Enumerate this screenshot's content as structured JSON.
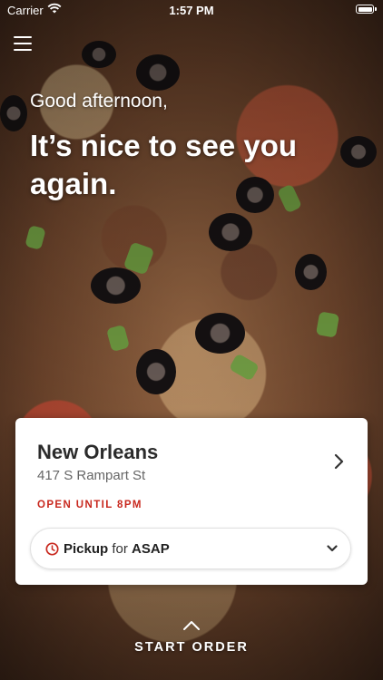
{
  "status_bar": {
    "carrier": "Carrier",
    "time": "1:57 PM",
    "wifi_icon": "wifi-icon",
    "battery_icon": "battery-icon"
  },
  "menu": {
    "icon": "hamburger-menu-icon"
  },
  "greeting": {
    "salutation": "Good afternoon,",
    "headline": "It’s nice to see you again."
  },
  "location_card": {
    "city": "New Orleans",
    "address": "417 S Rampart St",
    "hours": "OPEN UNTIL 8PM",
    "chevron_icon": "chevron-right-icon",
    "pickup": {
      "icon": "clock-icon",
      "mode": "Pickup",
      "connector": "for",
      "time": "ASAP",
      "dropdown_icon": "chevron-down-icon"
    }
  },
  "cta": {
    "label": "START ORDER",
    "icon": "chevron-up-icon"
  },
  "colors": {
    "accent_red": "#c8281e",
    "text_dark": "#2b2b2b",
    "card_bg": "#ffffff"
  }
}
